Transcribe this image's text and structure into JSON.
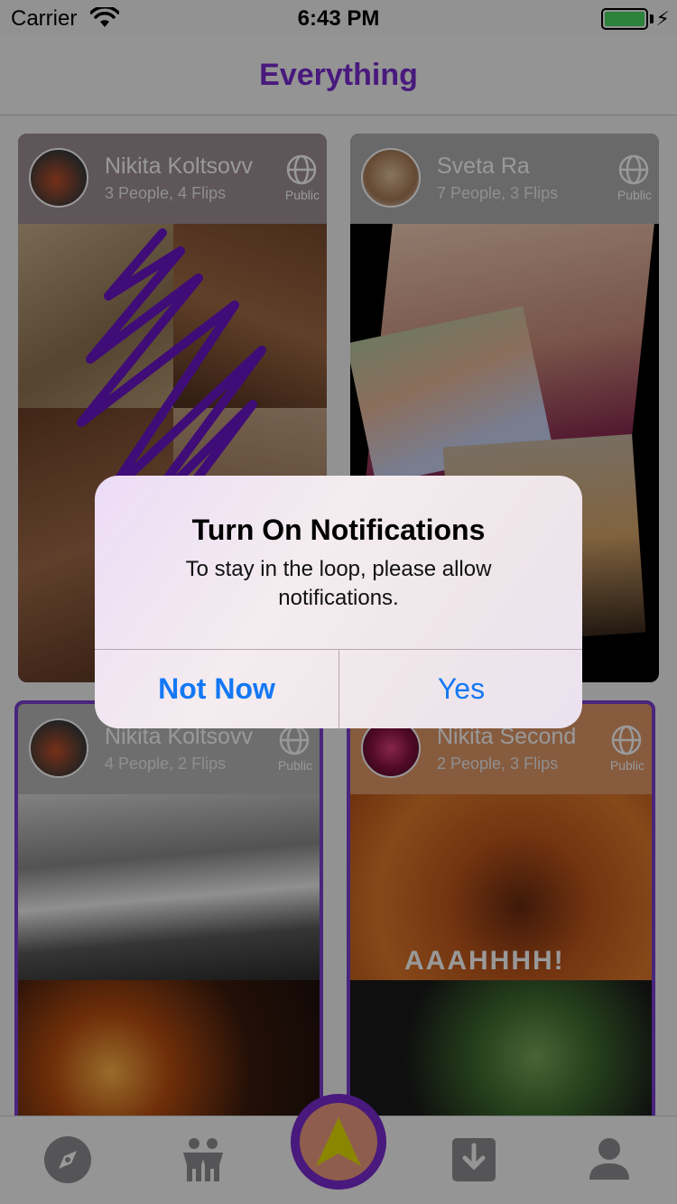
{
  "status": {
    "carrier": "Carrier",
    "time": "6:43 PM",
    "battery_level": 1.0
  },
  "nav": {
    "title": "Everything"
  },
  "cards": [
    {
      "name": "Nikita Koltsovv",
      "stats": "3 People, 4 Flips",
      "visibility": "Public"
    },
    {
      "name": "Sveta Ra",
      "stats": "7 People, 3 Flips",
      "visibility": "Public"
    },
    {
      "name": "Nikita Koltsovv",
      "stats": "4 People, 2 Flips",
      "visibility": "Public"
    },
    {
      "name": "Nikita Second",
      "stats": "2 People, 3 Flips",
      "visibility": "Public"
    }
  ],
  "gif_caption": "AAAHHHH!",
  "tabs": [
    "explore-icon",
    "people-icon",
    "create-icon",
    "inbox-icon",
    "profile-icon"
  ],
  "alert": {
    "title": "Turn On Notifications",
    "message": "To stay in the loop, please allow notifications.",
    "cancel_label": "Not Now",
    "confirm_label": "Yes"
  },
  "colors": {
    "accent": "#7a2bd0",
    "link": "#1478f5",
    "center_button_fill": "#ee9b82"
  }
}
